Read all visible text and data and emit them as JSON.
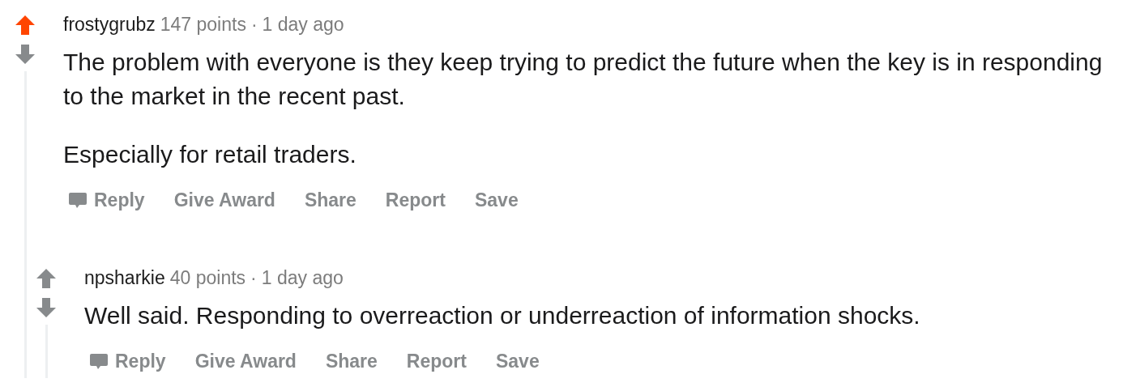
{
  "comments": [
    {
      "author": "frostygrubz",
      "points": "147 points",
      "separator": "·",
      "time": "1 day ago",
      "upvoted": true,
      "paragraphs": [
        "The problem with everyone is they keep trying to predict the future when the key is in responding to the market in the recent past.",
        "Especially for retail traders."
      ],
      "actions": [
        {
          "kind": "reply",
          "label": "Reply"
        },
        {
          "kind": "plain",
          "label": "Give Award"
        },
        {
          "kind": "plain",
          "label": "Share"
        },
        {
          "kind": "plain",
          "label": "Report"
        },
        {
          "kind": "plain",
          "label": "Save"
        }
      ],
      "children": [
        {
          "author": "npsharkie",
          "points": "40 points",
          "separator": "·",
          "time": "1 day ago",
          "upvoted": false,
          "paragraphs": [
            "Well said. Responding to overreaction or underreaction of information shocks."
          ],
          "actions": [
            {
              "kind": "reply",
              "label": "Reply"
            },
            {
              "kind": "plain",
              "label": "Give Award"
            },
            {
              "kind": "plain",
              "label": "Share"
            },
            {
              "kind": "plain",
              "label": "Report"
            },
            {
              "kind": "plain",
              "label": "Save"
            }
          ]
        }
      ]
    }
  ]
}
